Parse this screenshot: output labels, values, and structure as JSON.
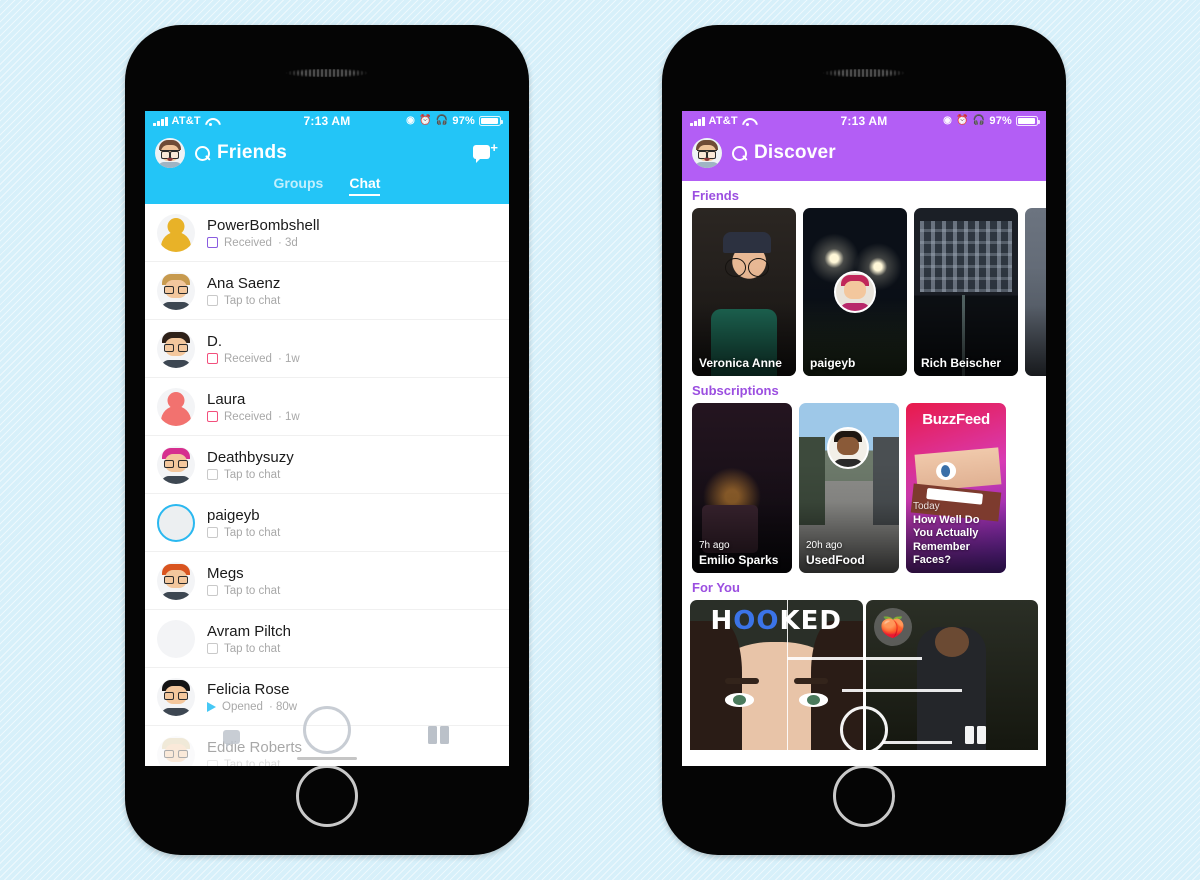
{
  "background": {
    "color": "#d7f0fa"
  },
  "phones": {
    "left": {
      "status_bar": {
        "carrier": "AT&T",
        "time": "7:13 AM",
        "battery_percent": "97%",
        "icons": [
          "signal-bars-icon",
          "wifi-icon",
          "location-arrow-icon",
          "alarm-icon",
          "headphones-icon",
          "battery-icon"
        ]
      },
      "header": {
        "accent_color": "#23c5f7",
        "title": "Friends",
        "avatar": "bitmoji-avatar",
        "search_icon": "search-icon",
        "new_chat_icon": "new-chat-icon"
      },
      "tabs": [
        {
          "label": "Groups",
          "active": false
        },
        {
          "label": "Chat",
          "active": true
        }
      ],
      "chats": [
        {
          "name": "PowerBombshell",
          "status": "Received",
          "time": "3d",
          "glyph": "square-purple",
          "avatar_type": "silhouette",
          "avatar_color": "#e8b228"
        },
        {
          "name": "Ana Saenz",
          "status": "Tap to chat",
          "time": "",
          "glyph": "square-grey",
          "avatar_type": "bitmoji",
          "avatar_color": "#c79a4e"
        },
        {
          "name": "D.",
          "status": "Received",
          "time": "1w",
          "glyph": "square-pink",
          "avatar_type": "bitmoji",
          "avatar_color": "#2e2119"
        },
        {
          "name": "Laura",
          "status": "Received",
          "time": "1w",
          "glyph": "square-pink",
          "avatar_type": "silhouette",
          "avatar_color": "#f2726f"
        },
        {
          "name": "Deathbysuzy",
          "status": "Tap to chat",
          "time": "",
          "glyph": "square-grey",
          "avatar_type": "bitmoji",
          "avatar_color": "#d62f8f"
        },
        {
          "name": "paigeyb",
          "status": "Tap to chat",
          "time": "",
          "glyph": "square-grey",
          "avatar_type": "ring",
          "avatar_color": "#2ab8f0"
        },
        {
          "name": "Megs",
          "status": "Tap to chat",
          "time": "",
          "glyph": "square-grey",
          "avatar_type": "bitmoji",
          "avatar_color": "#d9541f"
        },
        {
          "name": "Avram Piltch",
          "status": "Tap to chat",
          "time": "",
          "glyph": "square-grey",
          "avatar_type": "silhouette",
          "avatar_color": "#f2e9a"
        },
        {
          "name": "Felicia Rose",
          "status": "Opened",
          "time": "80w",
          "glyph": "triangle-blue",
          "avatar_type": "bitmoji",
          "avatar_color": "#141414"
        },
        {
          "name": "Eddie Roberts",
          "status": "Tap to chat",
          "time": "",
          "glyph": "square-grey",
          "avatar_type": "bitmoji",
          "avatar_color": "#d8c79a"
        }
      ],
      "camera_overlay": {
        "shutter": "camera-shutter-button",
        "memories": "memories-icon",
        "chat": "chat-icon"
      }
    },
    "right": {
      "status_bar": {
        "carrier": "AT&T",
        "time": "7:13 AM",
        "battery_percent": "97%",
        "icons": [
          "signal-bars-icon",
          "wifi-icon",
          "location-arrow-icon",
          "alarm-icon",
          "headphones-icon",
          "battery-icon"
        ]
      },
      "header": {
        "accent_color": "#b35ef5",
        "title": "Discover",
        "avatar": "bitmoji-avatar",
        "search_icon": "search-icon"
      },
      "sections": [
        {
          "title": "Friends",
          "title_color": "#9b4ee0",
          "cards": [
            {
              "caption": "Veronica Anne",
              "ago": "",
              "art": "a-veronica"
            },
            {
              "caption": "paigeyb",
              "ago": "",
              "art": "a-field"
            },
            {
              "caption": "Rich Beischer",
              "ago": "",
              "art": "a-bldg"
            },
            {
              "caption": "",
              "ago": "",
              "art": "a-grey"
            }
          ]
        },
        {
          "title": "Subscriptions",
          "title_color": "#9b4ee0",
          "cards": [
            {
              "caption": "Emilio Sparks",
              "ago": "7h ago",
              "art": "a-night"
            },
            {
              "caption": "UsedFood",
              "ago": "20h ago",
              "art": "a-street"
            },
            {
              "caption": "",
              "ago": "",
              "art": "a-buzz",
              "brand": "BuzzFeed",
              "today": "Today",
              "headline": "How Well Do You Actually Remember Faces?"
            }
          ]
        },
        {
          "title": "For You",
          "title_color": "#9b4ee0",
          "cards": [
            {
              "caption": "",
              "ago": "",
              "art": "a-hooked",
              "word_a": "H",
              "word_b": "OO",
              "word_c": "KED"
            },
            {
              "caption": "",
              "ago": "",
              "art": "a-stage",
              "emoji": "🍑"
            }
          ]
        }
      ],
      "camera_overlay": {
        "shutter": "camera-shutter-button",
        "memories": "memories-icon"
      }
    }
  }
}
